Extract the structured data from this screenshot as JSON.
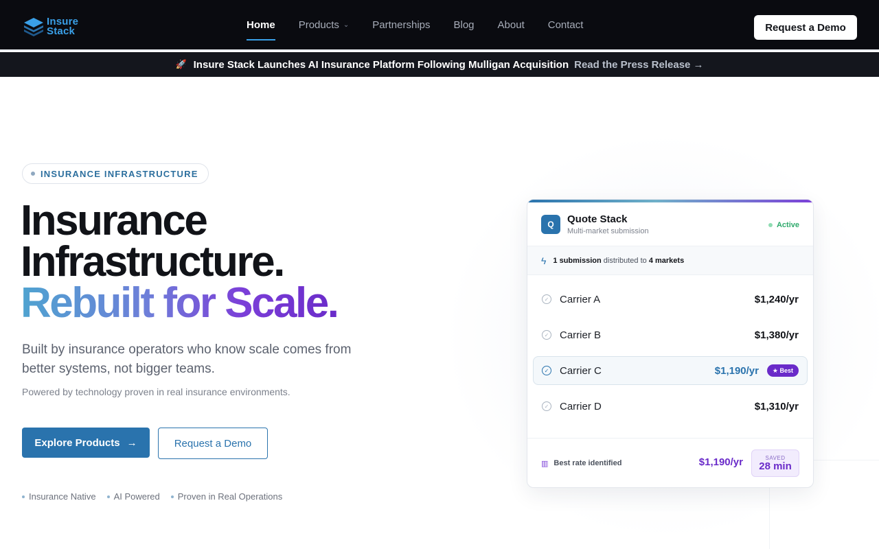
{
  "brand": {
    "name_line1": "Insure",
    "name_line2": "Stack"
  },
  "nav": {
    "items": [
      {
        "label": "Home",
        "active": true
      },
      {
        "label": "Products",
        "has_dropdown": true
      },
      {
        "label": "Partnerships"
      },
      {
        "label": "Blog"
      },
      {
        "label": "About"
      },
      {
        "label": "Contact"
      }
    ],
    "cta_label": "Request a Demo"
  },
  "announcement": {
    "icon": "rocket-icon",
    "message": "Insure Stack Launches AI Insurance Platform Following Mulligan Acquisition",
    "link_label": "Read the Press Release",
    "link_arrow": "→"
  },
  "hero": {
    "eyebrow": "INSURANCE INFRASTRUCTURE",
    "headline_line1": "Insurance",
    "headline_line2": "Infrastructure.",
    "headline_line3": "Rebuilt for Scale.",
    "subheading": "Built by insurance operators who know scale comes from better systems, not bigger teams.",
    "powered_by": "Powered by technology proven in real insurance environments.",
    "primary_cta": "Explore Products",
    "primary_cta_arrow": "→",
    "secondary_cta": "Request a Demo",
    "features": [
      "Insurance Native",
      "AI Powered",
      "Proven in Real Operations"
    ]
  },
  "quote_card": {
    "badge_letter": "Q",
    "title": "Quote Stack",
    "subtitle": "Multi-market submission",
    "status": "Active",
    "strip": {
      "count": "1 submission",
      "middle": " distributed to ",
      "markets": "4 markets"
    },
    "carriers": [
      {
        "name": "Carrier A",
        "price": "$1,240/yr"
      },
      {
        "name": "Carrier B",
        "price": "$1,380/yr"
      },
      {
        "name": "Carrier C",
        "price": "$1,190/yr",
        "best": true,
        "badge": "★ Best"
      },
      {
        "name": "Carrier D",
        "price": "$1,310/yr"
      }
    ],
    "footer": {
      "label": "Best rate identified",
      "price": "$1,190/yr",
      "saved_label": "SAVED",
      "saved_value": "28 min"
    }
  },
  "colors": {
    "nav_bg": "#0a0b10",
    "primary": "#2a73ad",
    "accent_purple": "#6a2bc9",
    "active_green": "#2ea96b"
  }
}
